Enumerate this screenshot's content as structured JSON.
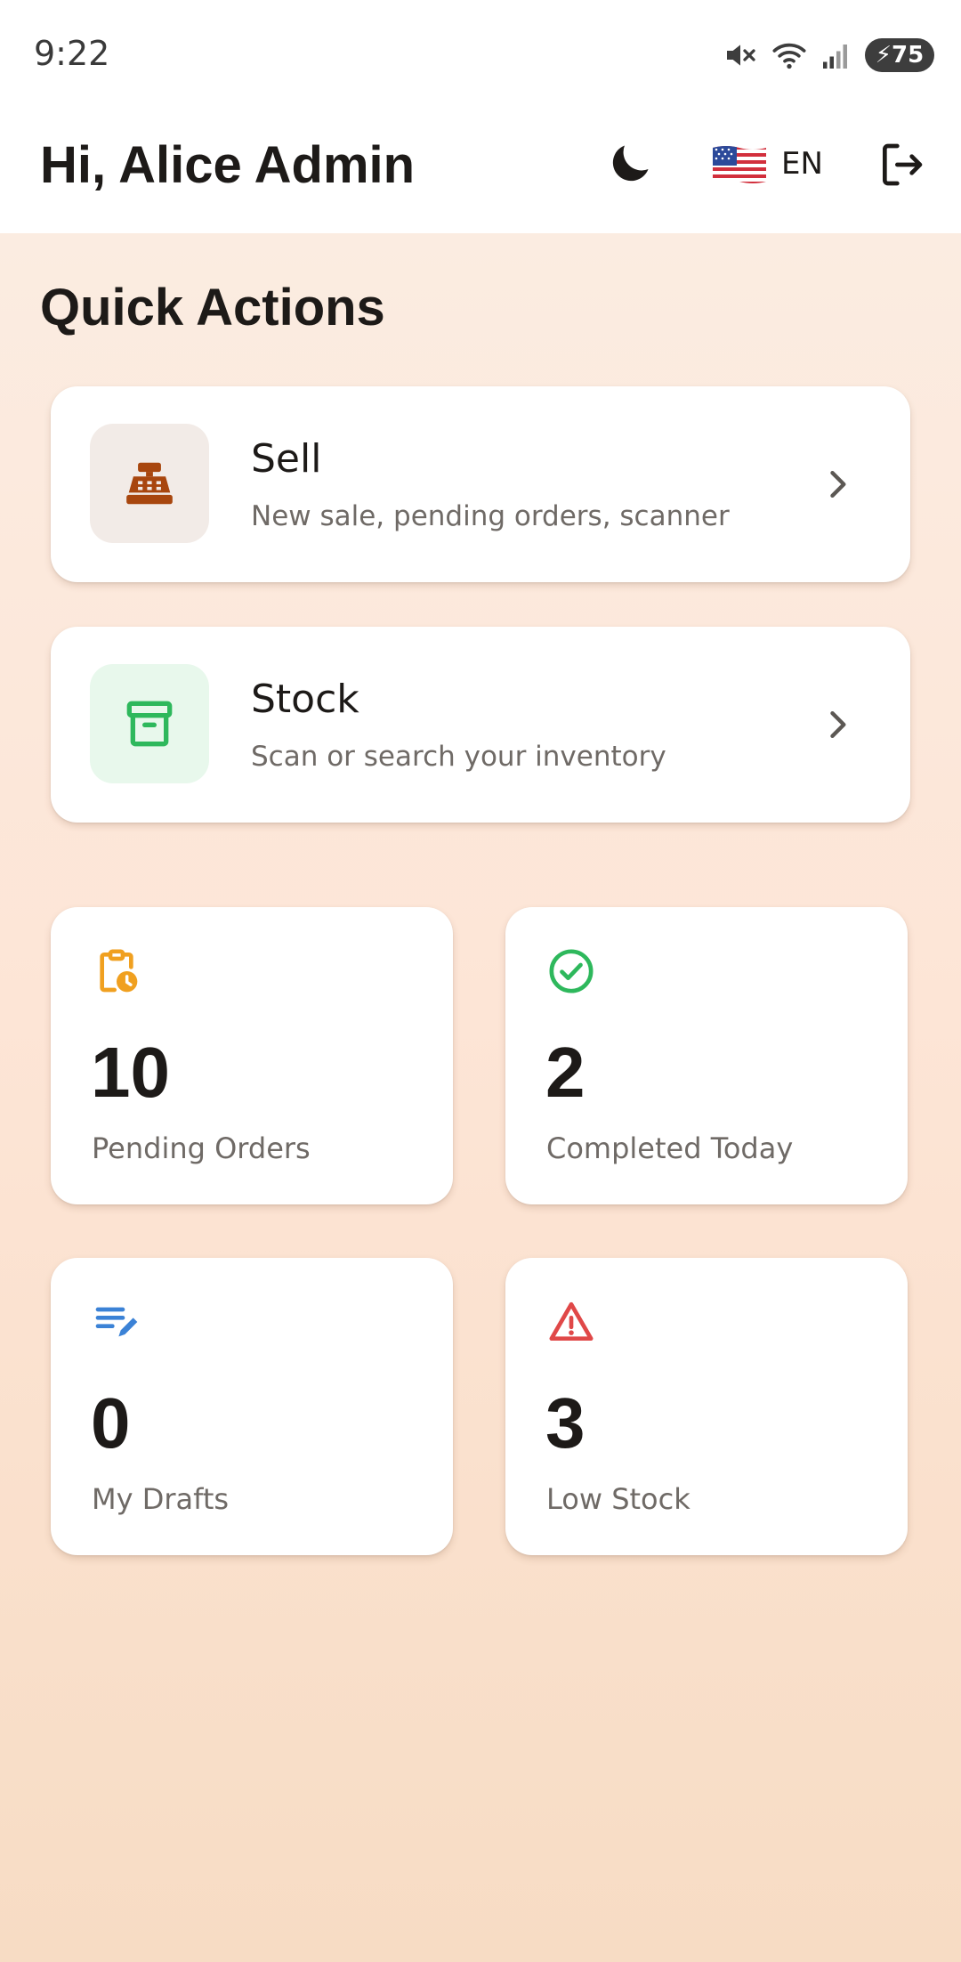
{
  "status_bar": {
    "time": "9:22",
    "battery": "75",
    "icons": [
      "mute-icon",
      "wifi-icon",
      "signal-icon",
      "battery-charging-icon"
    ]
  },
  "header": {
    "greeting": "Hi, Alice Admin",
    "theme_icon": "moon-icon",
    "language": "EN",
    "flag_icon": "us-flag-icon",
    "logout_icon": "logout-icon"
  },
  "quick_actions": {
    "title": "Quick Actions",
    "items": [
      {
        "title": "Sell",
        "subtitle": "New sale, pending orders, scanner",
        "icon": "cash-register-icon",
        "icon_color": "#a8460e",
        "icon_bg": "#f2ebe7"
      },
      {
        "title": "Stock",
        "subtitle": "Scan or search your inventory",
        "icon": "archive-box-icon",
        "icon_color": "#2eb85c",
        "icon_bg": "#e8f8ec"
      }
    ]
  },
  "stats": [
    {
      "value": "10",
      "label": "Pending Orders",
      "icon": "clipboard-clock-icon",
      "color": "#f0a020"
    },
    {
      "value": "2",
      "label": "Completed Today",
      "icon": "check-circle-icon",
      "color": "#2eb85c"
    },
    {
      "value": "0",
      "label": "My Drafts",
      "icon": "edit-note-icon",
      "color": "#3b82d6"
    },
    {
      "value": "3",
      "label": "Low Stock",
      "icon": "warning-icon",
      "color": "#e04848"
    }
  ]
}
